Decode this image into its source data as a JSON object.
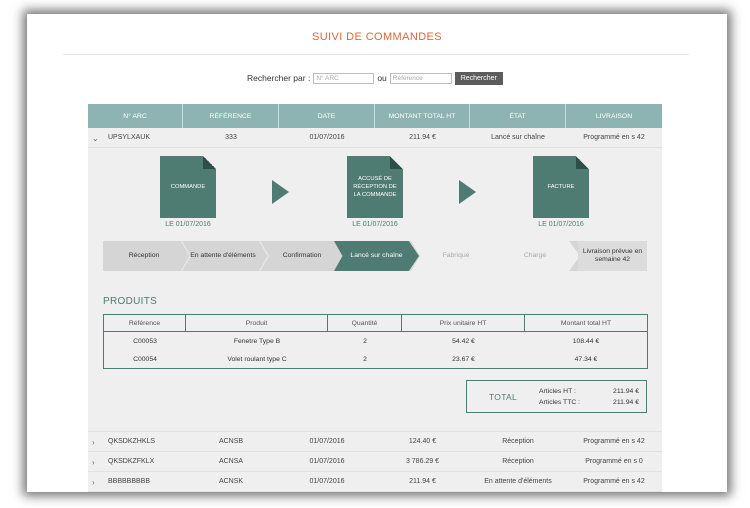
{
  "page": {
    "title": "SUIVI DE COMMANDES"
  },
  "search": {
    "label": "Rechercher par :",
    "arc_placeholder": "N° ARC",
    "or_label": "ou",
    "ref_placeholder": "Référence",
    "button_label": "Rechercher"
  },
  "table": {
    "headers": [
      "N° ARC",
      "RÉFÉRENCE",
      "DATE",
      "MONTANT TOTAL HT",
      "ÉTAT",
      "LIVRAISON"
    ],
    "rows": [
      {
        "arc": "UPSYLXAUK",
        "ref": "333",
        "date": "01/07/2016",
        "amount": "211.94 €",
        "state": "Lancé sur chaîne",
        "delivery": "Programmé en s 42",
        "expanded": true
      },
      {
        "arc": "QKSDKZHKLS",
        "ref": "ACNSB",
        "date": "01/07/2016",
        "amount": "124.40 €",
        "state": "Réception",
        "delivery": "Programmé en s 42",
        "expanded": false
      },
      {
        "arc": "QKSDKZFKLX",
        "ref": "ACNSA",
        "date": "01/07/2016",
        "amount": "3 786.29 €",
        "state": "Réception",
        "delivery": "Programmé en s 0",
        "expanded": false
      },
      {
        "arc": "BBBBBBBBB",
        "ref": "ACNSK",
        "date": "01/07/2016",
        "amount": "211.94 €",
        "state": "En attente d'éléments",
        "delivery": "Programmé en s 42",
        "expanded": false
      }
    ]
  },
  "detail": {
    "docs": [
      {
        "label": "COMMANDE",
        "date": "LE 01/07/2016"
      },
      {
        "label": "ACCUSÉ DE RÉCEPTION DE LA COMMANDE",
        "date": "LE 01/07/2016"
      },
      {
        "label": "FACTURE",
        "date": "LE 01/07/2016"
      }
    ],
    "steps": [
      "Réception",
      "En attente d'éléments",
      "Confirmation",
      "Lancé sur chaîne",
      "Fabriqué",
      "Chargé"
    ],
    "delivery_note": "Livraison prévue en semaine 42",
    "products_title": "PRODUITS",
    "product_headers": [
      "Référence",
      "Produit",
      "Quantité",
      "Prix unitaire HT",
      "Montant total HT"
    ],
    "products": [
      {
        "ref": "C00053",
        "name": "Fenetre Type B",
        "qty": "2",
        "unit": "54.42 €",
        "total": "108.44 €"
      },
      {
        "ref": "C00054",
        "name": "Volet roulant type C",
        "qty": "2",
        "unit": "23.67 €",
        "total": "47.34 €"
      }
    ],
    "total_label": "TOTAL",
    "total_ht_label": "Articles HT :",
    "total_ht": "211.94 €",
    "total_ttc_label": "Articles TTC :",
    "total_ttc": "211.94 €"
  },
  "colors": {
    "accent": "#d8683a",
    "teal": "#4e7b72",
    "header_teal": "#8db4b2"
  }
}
